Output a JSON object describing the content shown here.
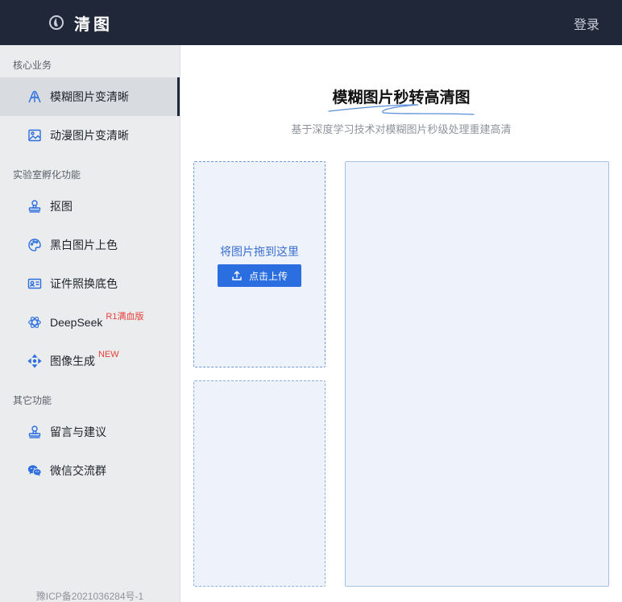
{
  "header": {
    "logo_text": "清图",
    "login_label": "登录"
  },
  "sidebar": {
    "sections": {
      "core": "核心业务",
      "lab": "实验室孵化功能",
      "other": "其它功能"
    },
    "items": [
      {
        "label": "模糊图片变清晰",
        "icon": "enhance-icon",
        "active": true
      },
      {
        "label": "动漫图片变清晰",
        "icon": "image-icon"
      },
      {
        "label": "抠图",
        "icon": "stamp-icon"
      },
      {
        "label": "黑白图片上色",
        "icon": "palette-icon"
      },
      {
        "label": "证件照换底色",
        "icon": "id-card-icon"
      },
      {
        "label": "DeepSeek",
        "icon": "deepseek-icon",
        "badge": "R1满血版"
      },
      {
        "label": "图像生成",
        "icon": "generate-icon",
        "badge": "NEW"
      },
      {
        "label": "留言与建议",
        "icon": "feedback-icon"
      },
      {
        "label": "微信交流群",
        "icon": "wechat-icon"
      }
    ],
    "footer": "豫ICP备2021036284号-1"
  },
  "main": {
    "title": "模糊图片秒转高清图",
    "subtitle": "基于深度学习技术对模糊图片秒级处理重建高清",
    "drop_hint": "将图片拖到这里",
    "upload_label": "点击上传"
  },
  "colors": {
    "header_bg": "#1f2738",
    "accent": "#2b6ee0",
    "badge": "#e8413b",
    "sidebar_bg": "#ebecee"
  }
}
